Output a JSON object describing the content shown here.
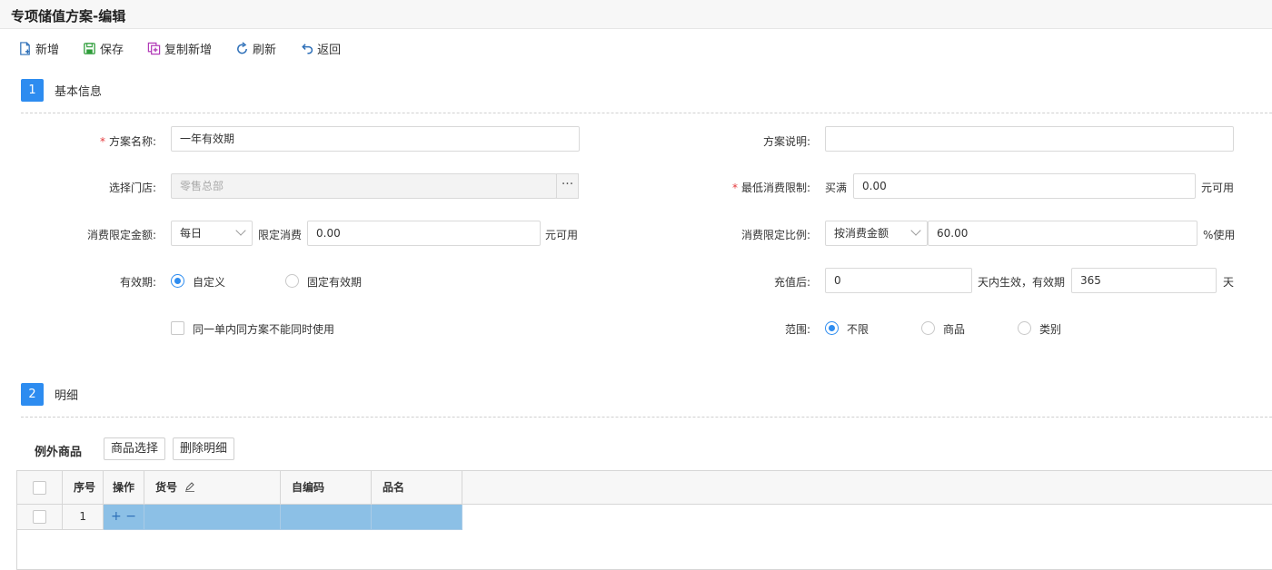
{
  "title": "专项储值方案-编辑",
  "toolbar": {
    "new_label": "新增",
    "save_label": "保存",
    "copy_new_label": "复制新增",
    "refresh_label": "刷新",
    "back_label": "返回"
  },
  "section1": {
    "number": "1",
    "title": "基本信息"
  },
  "form": {
    "plan_name": {
      "label": "方案名称:",
      "value": "一年有效期"
    },
    "plan_desc": {
      "label": "方案说明:",
      "value": ""
    },
    "store": {
      "label": "选择门店:",
      "value": "零售总部",
      "button": "···"
    },
    "min_consume": {
      "label": "最低消费限制:",
      "prefix": "买满",
      "value": "0.00",
      "suffix": "元可用"
    },
    "limit_amount": {
      "label": "消费限定金额:",
      "period": "每日",
      "middle": "限定消费",
      "value": "0.00",
      "suffix": "元可用"
    },
    "limit_ratio": {
      "label": "消费限定比例:",
      "mode": "按消费金额",
      "value": "60.00",
      "suffix": "%使用"
    },
    "validity": {
      "label": "有效期:",
      "opt_custom": "自定义",
      "opt_fixed": "固定有效期",
      "selected": "自定义"
    },
    "recharge": {
      "label": "充值后:",
      "days_effective": "0",
      "middle": "天内生效，有效期",
      "valid_days": "365",
      "suffix": "天"
    },
    "same_order_check": {
      "label": "同一单内同方案不能同时使用",
      "checked": false
    },
    "scope": {
      "label": "范围:",
      "opt_all": "不限",
      "opt_goods": "商品",
      "opt_category": "类别",
      "selected": "不限"
    }
  },
  "section2": {
    "number": "2",
    "title": "明细"
  },
  "detail": {
    "title": "例外商品",
    "select_goods_label": "商品选择",
    "delete_detail_label": "删除明细",
    "columns": {
      "seq": "序号",
      "action": "操作",
      "code": "货号",
      "self_code": "自编码",
      "name": "品名"
    },
    "rows": [
      {
        "seq": "1",
        "add": "+",
        "remove": "−",
        "code": "",
        "self_code": "",
        "name": ""
      }
    ]
  },
  "colors": {
    "accent": "#2d8cf0",
    "required": "#e4393c",
    "selected_row": "#8cc0e6"
  }
}
